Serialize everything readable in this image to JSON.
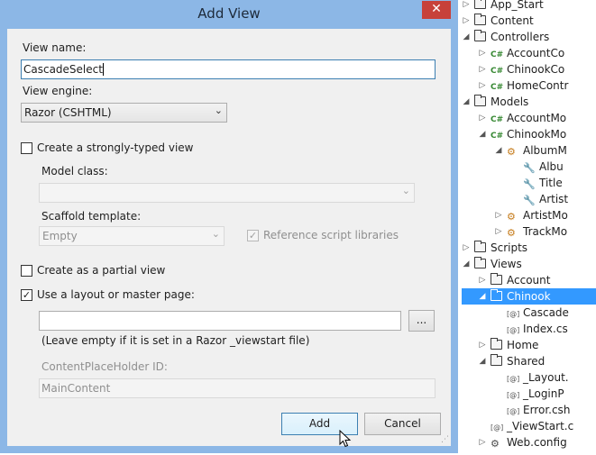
{
  "dialog": {
    "title": "Add View",
    "close_icon": "close-icon",
    "view_name_label": "View name:",
    "view_name_value": "CascadeSelect",
    "view_engine_label": "View engine:",
    "view_engine_value": "Razor (CSHTML)",
    "strongly_typed_label": "Create a strongly-typed view",
    "strongly_typed_checked": false,
    "model_class_label": "Model class:",
    "model_class_value": "",
    "scaffold_label": "Scaffold template:",
    "scaffold_value": "Empty",
    "reference_scripts_label": "Reference script libraries",
    "reference_scripts_checked": true,
    "partial_view_label": "Create as a partial view",
    "partial_view_checked": false,
    "layout_label": "Use a layout or master page:",
    "layout_checked": true,
    "layout_path_value": "",
    "browse_label": "...",
    "layout_hint": "(Leave empty if it is set in a Razor _viewstart file)",
    "placeholder_id_label": "ContentPlaceHolder ID:",
    "placeholder_id_value": "MainContent",
    "add_label": "Add",
    "cancel_label": "Cancel"
  },
  "solution_explorer": {
    "items": [
      {
        "label": "App_Start",
        "icon": "folder-icon",
        "expander": "collapsed"
      },
      {
        "label": "Content",
        "icon": "folder-icon",
        "expander": "collapsed"
      },
      {
        "label": "Controllers",
        "icon": "folder-icon",
        "expander": "expanded"
      },
      {
        "label": "AccountCo",
        "icon": "csharp-file-icon",
        "expander": "collapsed"
      },
      {
        "label": "ChinookCo",
        "icon": "csharp-file-icon",
        "expander": "collapsed"
      },
      {
        "label": "HomeContr",
        "icon": "csharp-file-icon",
        "expander": "collapsed"
      },
      {
        "label": "Models",
        "icon": "folder-icon",
        "expander": "expanded"
      },
      {
        "label": "AccountMo",
        "icon": "csharp-file-icon",
        "expander": "collapsed"
      },
      {
        "label": "ChinookMo",
        "icon": "csharp-file-icon",
        "expander": "expanded"
      },
      {
        "label": "AlbumM",
        "icon": "class-icon",
        "expander": "expanded"
      },
      {
        "label": "Albu",
        "icon": "property-icon",
        "expander": "none"
      },
      {
        "label": "Title",
        "icon": "property-icon",
        "expander": "none"
      },
      {
        "label": "Artist",
        "icon": "property-icon",
        "expander": "none"
      },
      {
        "label": "ArtistMo",
        "icon": "class-icon",
        "expander": "collapsed"
      },
      {
        "label": "TrackMo",
        "icon": "class-icon",
        "expander": "collapsed"
      },
      {
        "label": "Scripts",
        "icon": "folder-icon",
        "expander": "collapsed"
      },
      {
        "label": "Views",
        "icon": "folder-icon",
        "expander": "expanded"
      },
      {
        "label": "Account",
        "icon": "folder-icon",
        "expander": "collapsed"
      },
      {
        "label": "Chinook",
        "icon": "folder-icon",
        "expander": "expanded",
        "selected": true
      },
      {
        "label": "Cascade",
        "icon": "razor-view-icon",
        "expander": "none"
      },
      {
        "label": "Index.cs",
        "icon": "razor-view-icon",
        "expander": "none"
      },
      {
        "label": "Home",
        "icon": "folder-icon",
        "expander": "collapsed"
      },
      {
        "label": "Shared",
        "icon": "folder-icon",
        "expander": "expanded"
      },
      {
        "label": "_Layout.",
        "icon": "razor-view-icon",
        "expander": "none"
      },
      {
        "label": "_LoginP",
        "icon": "razor-view-icon",
        "expander": "none"
      },
      {
        "label": "Error.csh",
        "icon": "razor-view-icon",
        "expander": "none"
      },
      {
        "label": "_ViewStart.c",
        "icon": "razor-view-icon",
        "expander": "none"
      },
      {
        "label": "Web.config",
        "icon": "config-file-icon",
        "expander": "collapsed"
      }
    ]
  }
}
